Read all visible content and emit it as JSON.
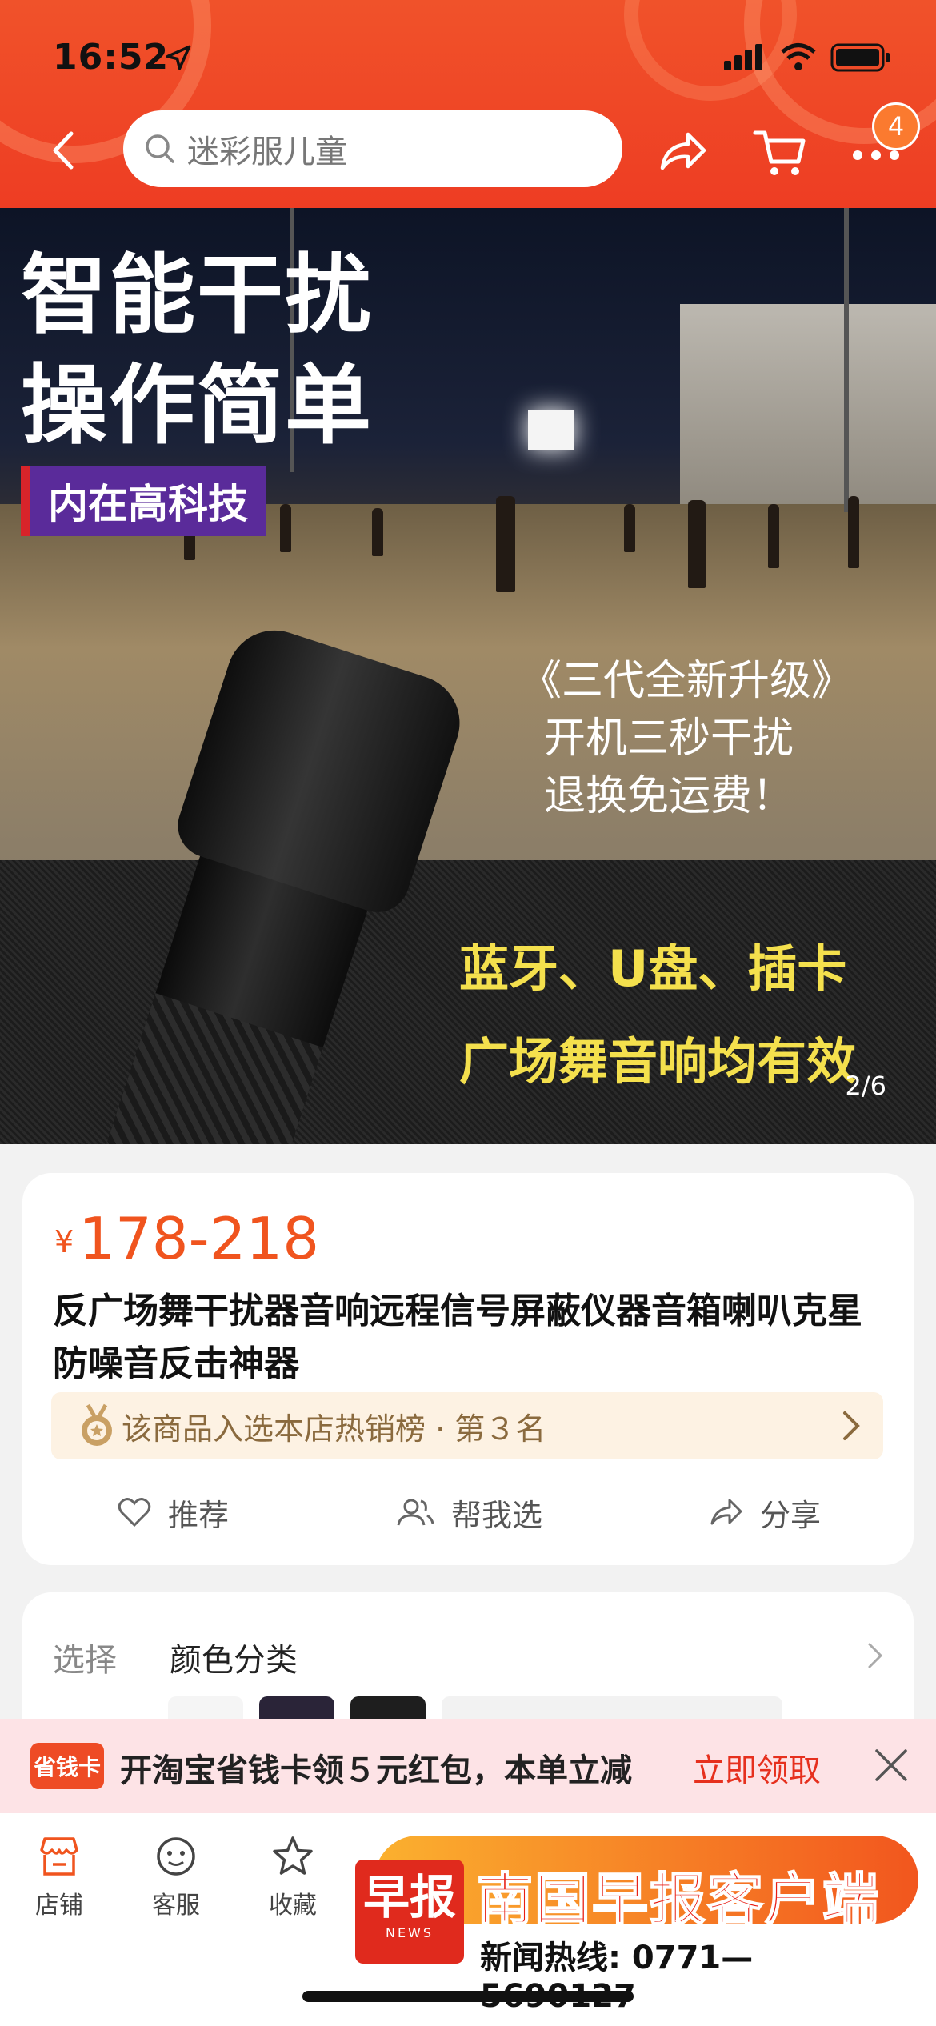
{
  "status_bar": {
    "time": "16:52"
  },
  "header": {
    "search_placeholder": "迷彩服儿童",
    "cart_badge": "4"
  },
  "hero": {
    "text_line1": "智能干扰",
    "text_line2": "操作简单",
    "text_tag": "内在高科技",
    "text_promo1": "《三代全新升级》",
    "text_promo2": "开机三秒干扰",
    "text_promo3": "退换免运费！",
    "text_feature1": "蓝牙、U盘、插卡",
    "text_feature2": "广场舞音响均有效",
    "page_indicator": "2/6"
  },
  "product": {
    "currency": "¥",
    "price": "178-218",
    "title": "反广场舞干扰器音响远程信号屏蔽仪器音箱喇叭克星防噪音反击神器",
    "rank_text": "该商品入选本店热销榜 · 第３名",
    "actions": [
      {
        "label": "推荐",
        "icon": "heart-icon"
      },
      {
        "label": "帮我选",
        "icon": "people-icon"
      },
      {
        "label": "分享",
        "icon": "share-icon"
      }
    ]
  },
  "selection": {
    "label": "选择",
    "value": "颜色分类"
  },
  "promo": {
    "tag": "省钱卡",
    "text": "开淘宝省钱卡领５元红包，本单立减",
    "link": "立即领取"
  },
  "bottom_bar": {
    "tabs": [
      {
        "label": "店铺",
        "icon": "store-icon"
      },
      {
        "label": "客服",
        "icon": "customer-service-icon"
      },
      {
        "label": "收藏",
        "icon": "star-icon"
      }
    ]
  },
  "ad": {
    "logo_text": "早报",
    "logo_sub": "NEWS",
    "name": "南国早报客户端",
    "hotline": "新闻热线: 0771— 5690127"
  },
  "colors": {
    "header_red": "#ee3d23",
    "price_orange": "#f0541e",
    "promo_link": "#e6301e",
    "feature_yellow": "#f4e04d"
  }
}
